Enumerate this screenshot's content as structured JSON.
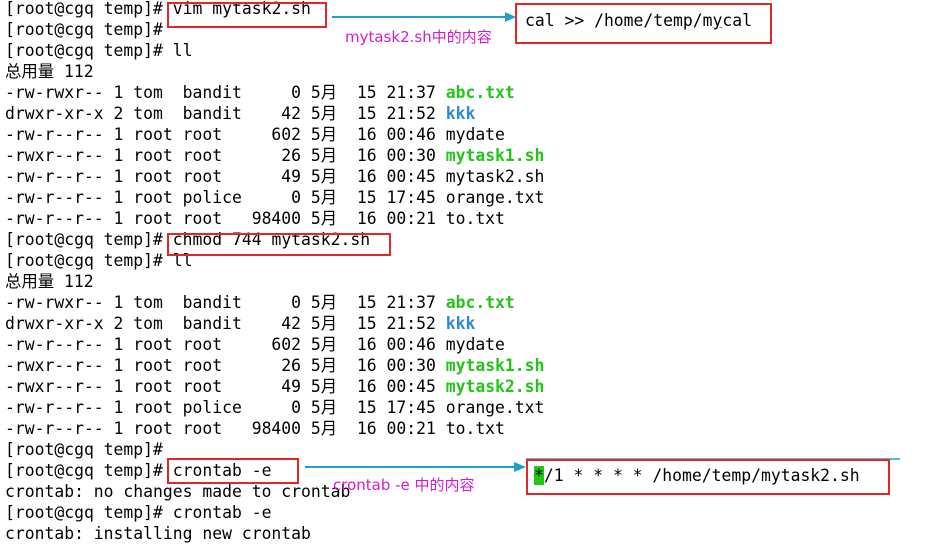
{
  "terminal": {
    "lines": [
      {
        "segments": [
          {
            "text": "[root@cgq temp]# ",
            "style": "plain"
          },
          {
            "text": "vim mytask2.sh",
            "style": "plain"
          }
        ]
      },
      {
        "segments": [
          {
            "text": "[root@cgq temp]#",
            "style": "plain"
          }
        ]
      },
      {
        "segments": [
          {
            "text": "[root@cgq temp]# ll",
            "style": "plain"
          }
        ]
      },
      {
        "segments": [
          {
            "text": "总用量 112",
            "style": "plain"
          }
        ]
      },
      {
        "segments": [
          {
            "text": "-rw-rwxr-- 1 tom  bandit     0 5月  15 21:37 ",
            "style": "plain"
          },
          {
            "text": "abc.txt",
            "style": "green"
          }
        ]
      },
      {
        "segments": [
          {
            "text": "drwxr-xr-x 2 tom  bandit    42 5月  15 21:52 ",
            "style": "plain"
          },
          {
            "text": "kkk",
            "style": "blue"
          }
        ]
      },
      {
        "segments": [
          {
            "text": "-rw-r--r-- 1 root root     602 5月  16 00:46 mydate",
            "style": "plain"
          }
        ]
      },
      {
        "segments": [
          {
            "text": "-rwxr--r-- 1 root root      26 5月  16 00:30 ",
            "style": "plain"
          },
          {
            "text": "mytask1.sh",
            "style": "green"
          }
        ]
      },
      {
        "segments": [
          {
            "text": "-rw-r--r-- 1 root root      49 5月  16 00:45 mytask2.sh",
            "style": "plain"
          }
        ]
      },
      {
        "segments": [
          {
            "text": "-rw-r--r-- 1 root police     0 5月  15 17:45 orange.txt",
            "style": "plain"
          }
        ]
      },
      {
        "segments": [
          {
            "text": "-rw-r--r-- 1 root root   98400 5月  16 00:21 to.txt",
            "style": "plain"
          }
        ]
      },
      {
        "segments": [
          {
            "text": "[root@cgq temp]# ",
            "style": "plain"
          },
          {
            "text": "chmod 744 mytask2.sh",
            "style": "plain"
          }
        ]
      },
      {
        "segments": [
          {
            "text": "[root@cgq temp]# ll",
            "style": "plain"
          }
        ]
      },
      {
        "segments": [
          {
            "text": "总用量 112",
            "style": "plain"
          }
        ]
      },
      {
        "segments": [
          {
            "text": "-rw-rwxr-- 1 tom  bandit     0 5月  15 21:37 ",
            "style": "plain"
          },
          {
            "text": "abc.txt",
            "style": "green"
          }
        ]
      },
      {
        "segments": [
          {
            "text": "drwxr-xr-x 2 tom  bandit    42 5月  15 21:52 ",
            "style": "plain"
          },
          {
            "text": "kkk",
            "style": "blue"
          }
        ]
      },
      {
        "segments": [
          {
            "text": "-rw-r--r-- 1 root root     602 5月  16 00:46 mydate",
            "style": "plain"
          }
        ]
      },
      {
        "segments": [
          {
            "text": "-rwxr--r-- 1 root root      26 5月  16 00:30 ",
            "style": "plain"
          },
          {
            "text": "mytask1.sh",
            "style": "green"
          }
        ]
      },
      {
        "segments": [
          {
            "text": "-rwxr--r-- 1 root root      49 5月  16 00:45 ",
            "style": "plain"
          },
          {
            "text": "mytask2.sh",
            "style": "green"
          }
        ]
      },
      {
        "segments": [
          {
            "text": "-rw-r--r-- 1 root police     0 5月  15 17:45 orange.txt",
            "style": "plain"
          }
        ]
      },
      {
        "segments": [
          {
            "text": "-rw-r--r-- 1 root root   98400 5月  16 00:21 to.txt",
            "style": "plain"
          }
        ]
      },
      {
        "segments": [
          {
            "text": "[root@cgq temp]#",
            "style": "plain"
          }
        ]
      },
      {
        "segments": [
          {
            "text": "[root@cgq temp]# ",
            "style": "plain"
          },
          {
            "text": "crontab -e",
            "style": "plain"
          }
        ]
      },
      {
        "segments": [
          {
            "text": "crontab: no changes made to crontab",
            "style": "plain"
          }
        ]
      },
      {
        "segments": [
          {
            "text": "[root@cgq temp]# crontab -e",
            "style": "plain"
          }
        ]
      },
      {
        "segments": [
          {
            "text": "crontab: installing new crontab",
            "style": "plain"
          }
        ]
      }
    ]
  },
  "annotations": {
    "note1": "mytask2.sh中的内容",
    "popup1": {
      "before": "cal >> /home/temp/m",
      "cursor": "y",
      "after": "cal"
    },
    "note2": "crontab -e 中的内容",
    "popup2": {
      "cursor": "*",
      "after": "/1 * * * * /home/temp/mytask2.sh"
    }
  },
  "colors": {
    "executable": "#25c41b",
    "directory": "#2d8bd6",
    "highlight_box": "#e0282a",
    "note_text": "#d11cd1",
    "arrow": "#1fa0c8"
  }
}
